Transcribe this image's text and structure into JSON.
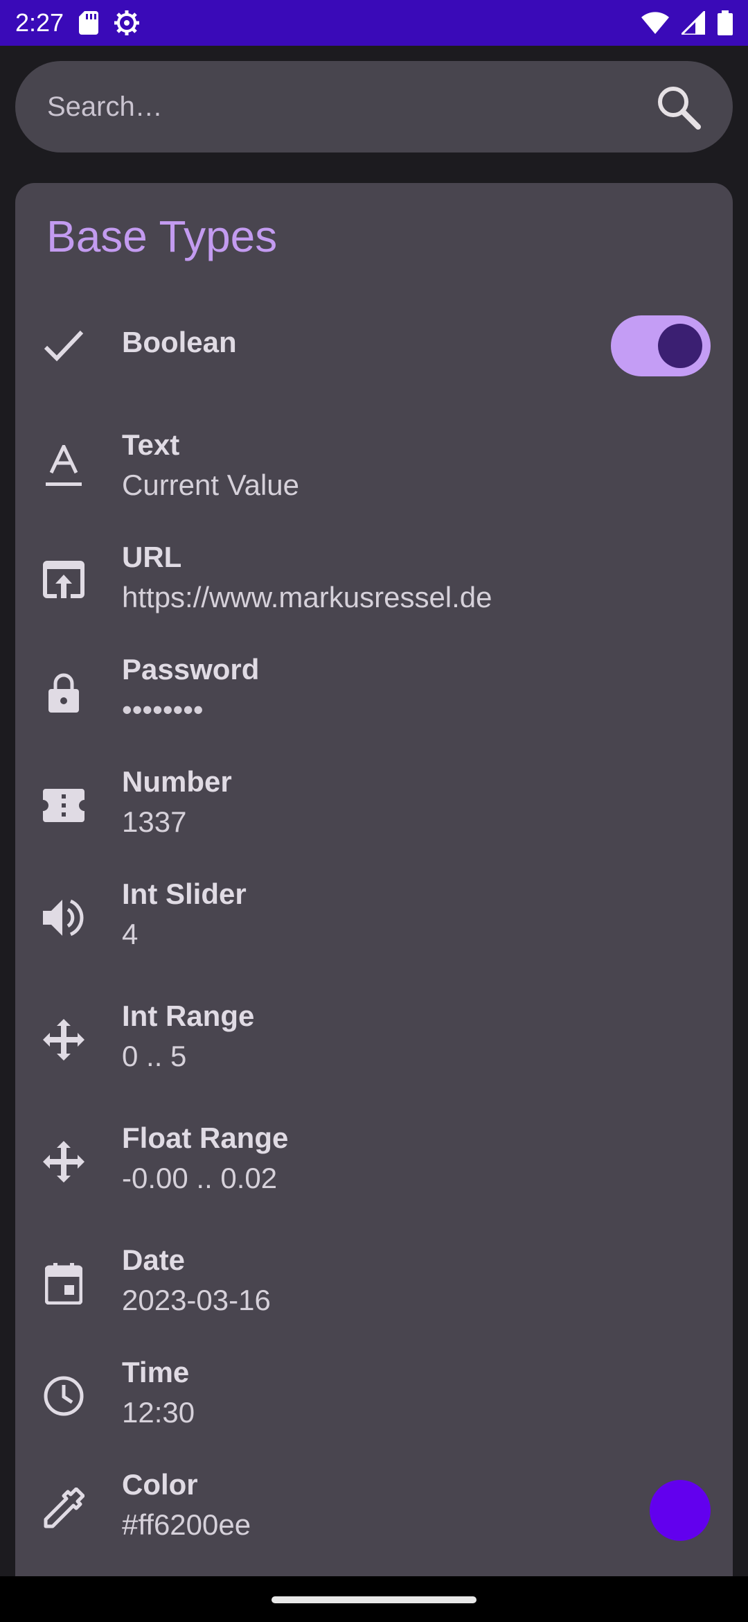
{
  "status_bar": {
    "time": "2:27",
    "icons": [
      "sd-card-icon",
      "settings-gear-icon",
      "wifi-icon",
      "signal-icon",
      "battery-icon"
    ]
  },
  "search": {
    "placeholder": "Search…"
  },
  "section": {
    "title": "Base Types"
  },
  "preferences": [
    {
      "icon": "check-icon",
      "title": "Boolean",
      "summary": "",
      "toggle_on": true
    },
    {
      "icon": "text-format-icon",
      "title": "Text",
      "summary": "Current Value"
    },
    {
      "icon": "open-in-browser-icon",
      "title": "URL",
      "summary": "https://www.markusressel.de"
    },
    {
      "icon": "lock-icon",
      "title": "Password",
      "summary": "••••••••"
    },
    {
      "icon": "ticket-icon",
      "title": "Number",
      "summary": "1337"
    },
    {
      "icon": "volume-icon",
      "title": "Int Slider",
      "summary": "4"
    },
    {
      "icon": "move-arrows-icon",
      "title": "Int Range",
      "summary": "0 .. 5"
    },
    {
      "icon": "move-arrows-icon",
      "title": "Float Range",
      "summary": "-0.00 .. 0.02"
    },
    {
      "icon": "calendar-icon",
      "title": "Date",
      "summary": "2023-03-16"
    },
    {
      "icon": "clock-icon",
      "title": "Time",
      "summary": "12:30"
    },
    {
      "icon": "color-picker-icon",
      "title": "Color",
      "summary": "#ff6200ee"
    }
  ],
  "colors": {
    "status_bar": "#3a0ab8",
    "accent": "#c39bf0",
    "swatch": "#6200ee"
  }
}
